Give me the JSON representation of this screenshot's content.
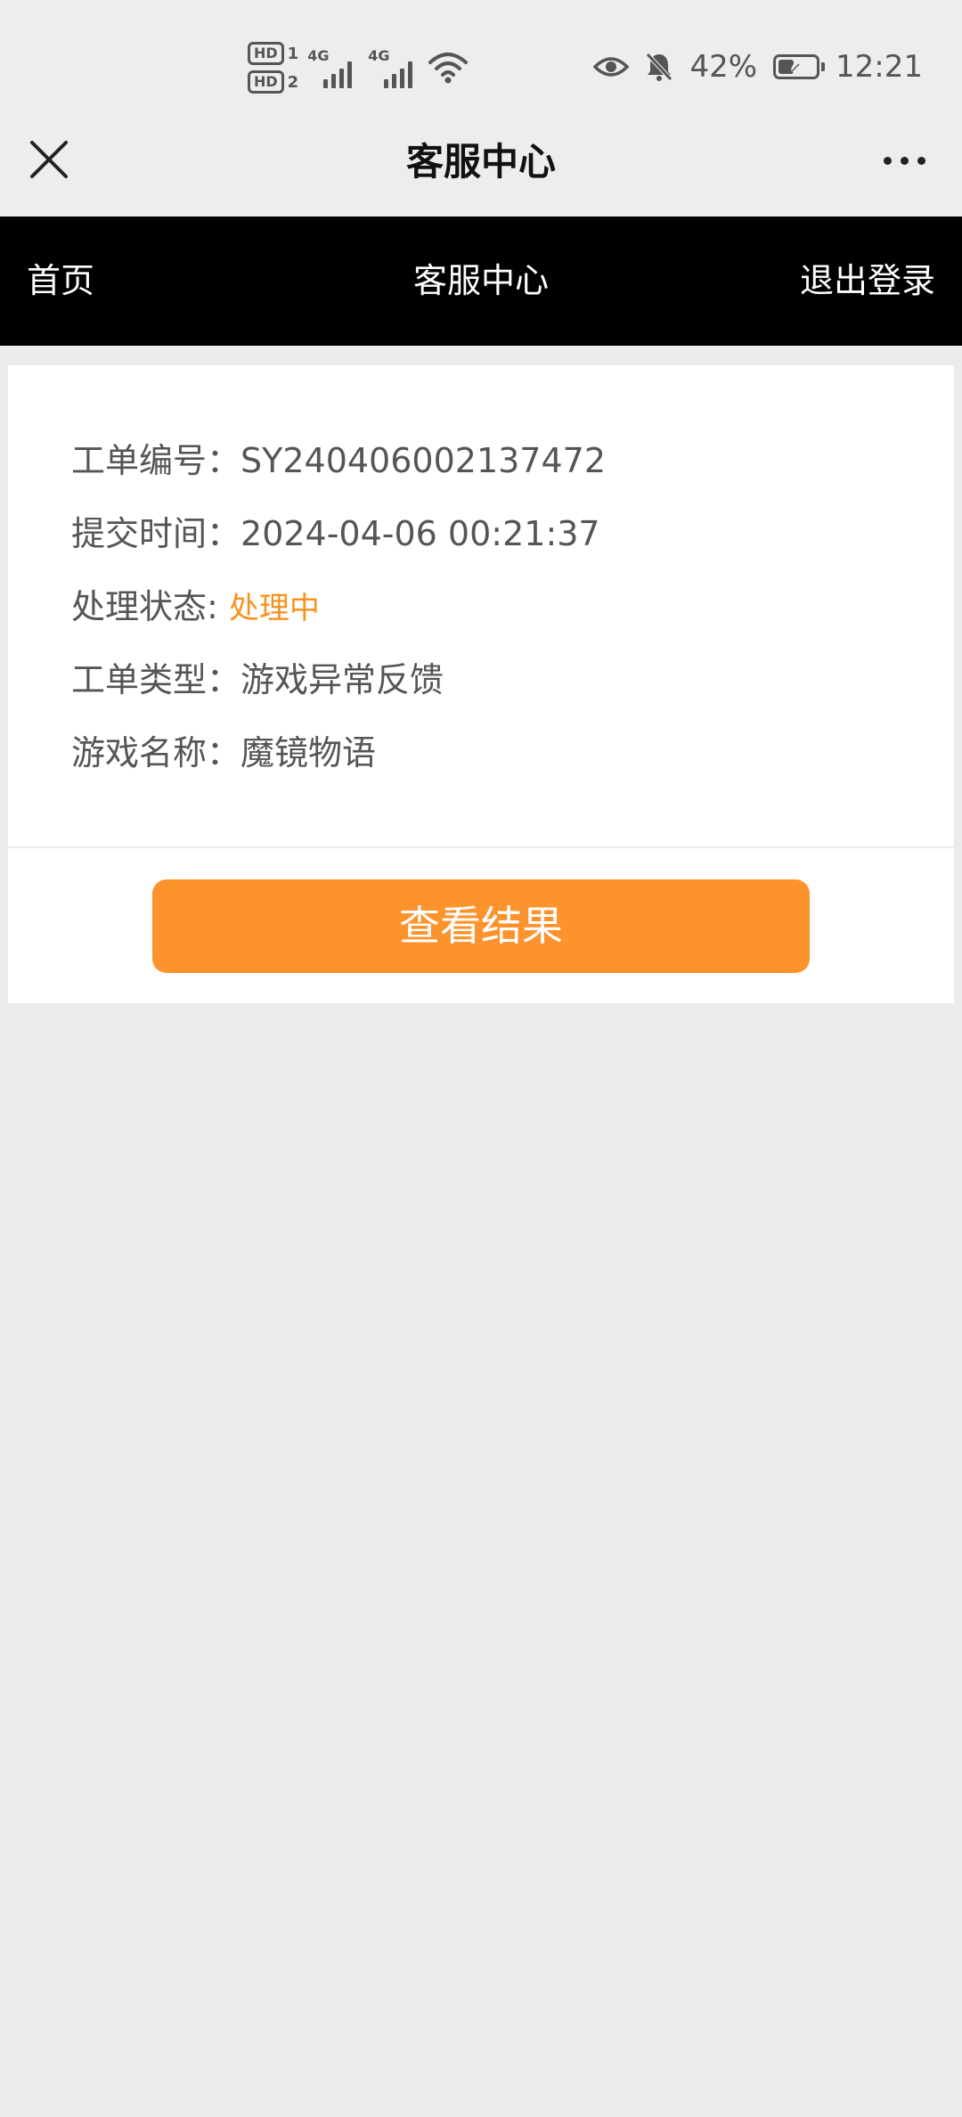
{
  "status_bar": {
    "hd1": "HD",
    "hd1_sub": "1",
    "hd2": "HD",
    "hd2_sub": "2",
    "net1": "4G",
    "net2": "4G",
    "battery_percent": "42%",
    "battery_level": 0.42,
    "time": "12:21",
    "icons": [
      "eye-icon",
      "bell-off-icon",
      "wifi-icon",
      "battery-icon"
    ]
  },
  "title_bar": {
    "title": "客服中心",
    "close_icon": "close-icon",
    "more_icon": "more-icon"
  },
  "nav": {
    "home": "首页",
    "center": "客服中心",
    "logout": "退出登录"
  },
  "ticket": {
    "rows": [
      {
        "label": "工单编号：",
        "value": "SY240406002137472"
      },
      {
        "label": "提交时间：",
        "value": "2024-04-06 00:21:37"
      },
      {
        "label": "处理状态: ",
        "value": "处理中"
      },
      {
        "label": "工单类型：",
        "value": "游戏异常反馈"
      },
      {
        "label": "游戏名称：",
        "value": "魔镜物语"
      }
    ],
    "button_label": "查看结果"
  },
  "colors": {
    "accent": "#fd932d",
    "status": "#f7921e",
    "nav_bg": "#000000",
    "page_bg": "#ebebeb"
  }
}
